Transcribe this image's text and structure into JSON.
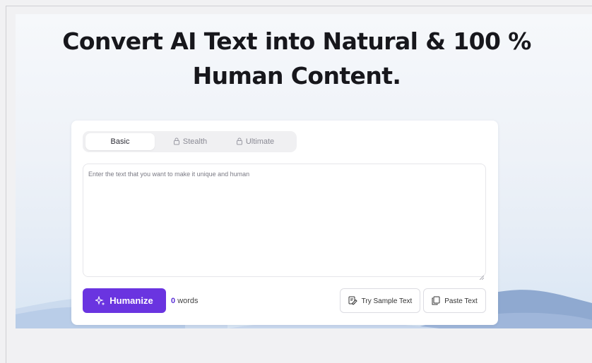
{
  "headline": {
    "line1": "Convert AI Text into Natural & 100 %",
    "line2": "Human Content."
  },
  "tabs": [
    {
      "label": "Basic",
      "active": true,
      "locked": false
    },
    {
      "label": "Stealth",
      "active": false,
      "locked": true
    },
    {
      "label": "Ultimate",
      "active": false,
      "locked": true
    }
  ],
  "editor": {
    "placeholder": "Enter the text that you want to make it unique and human",
    "value": ""
  },
  "actions": {
    "humanize_label": "Humanize",
    "word_count": "0",
    "word_count_suffix": "words",
    "try_sample_label": "Try Sample Text",
    "paste_label": "Paste Text"
  },
  "colors": {
    "accent": "#6a34e0",
    "headline": "#17171c",
    "card_bg": "#ffffff"
  },
  "icons": [
    "lock-icon",
    "sparkle-icon",
    "sample-text-icon",
    "paste-icon",
    "resize-grip-icon"
  ]
}
